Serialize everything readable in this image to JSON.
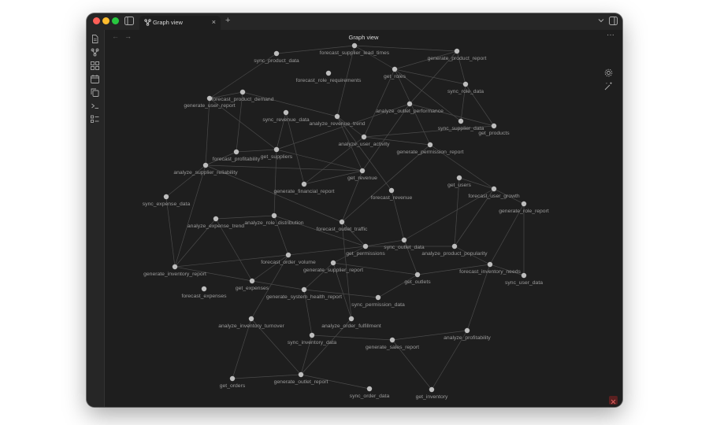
{
  "window": {
    "tab_label": "Graph view",
    "tab_close": "×",
    "new_tab": "+",
    "view_title": "Graph view",
    "nav_back": "←",
    "nav_forward": "→",
    "more_options": "···"
  },
  "colors": {
    "window_bg": "#1e1e1e",
    "node": "#bdbdbd",
    "edge": "#4a4a4a",
    "label": "#9a9a9a"
  },
  "graph": {
    "nodes": [
      {
        "id": "sync_product_data",
        "label": "sync_product_data"
      },
      {
        "id": "forecast_supplier_lead_times",
        "label": "forecast_supplier_lead_times"
      },
      {
        "id": "generate_product_report",
        "label": "generate_product_report"
      },
      {
        "id": "get_roles",
        "label": "get_roles"
      },
      {
        "id": "forecast_role_requirements",
        "label": "forecast_role_requirements"
      },
      {
        "id": "sync_role_data",
        "label": "sync_role_data"
      },
      {
        "id": "forecast_product_demand",
        "label": "forecast_product_demand"
      },
      {
        "id": "generate_user_report",
        "label": "generate_user_report"
      },
      {
        "id": "analyze_outlet_performance",
        "label": "analyze_outlet_performance"
      },
      {
        "id": "sync_revenue_data",
        "label": "sync_revenue_data"
      },
      {
        "id": "analyze_revenue_trend",
        "label": "analyze_revenue_trend"
      },
      {
        "id": "sync_supplier_data",
        "label": "sync_supplier_data"
      },
      {
        "id": "get_products",
        "label": "get_products"
      },
      {
        "id": "analyze_user_activity",
        "label": "analyze_user_activity"
      },
      {
        "id": "generate_permission_report",
        "label": "generate_permission_report"
      },
      {
        "id": "forecast_profitability",
        "label": "forecast_profitability"
      },
      {
        "id": "get_suppliers",
        "label": "get_suppliers"
      },
      {
        "id": "analyze_supplier_reliability",
        "label": "analyze_supplier_reliability"
      },
      {
        "id": "get_revenue",
        "label": "get_revenue"
      },
      {
        "id": "generate_financial_report",
        "label": "generate_financial_report"
      },
      {
        "id": "get_users",
        "label": "get_users"
      },
      {
        "id": "forecast_user_growth",
        "label": "forecast_user_growth"
      },
      {
        "id": "forecast_revenue",
        "label": "forecast_revenue"
      },
      {
        "id": "generate_role_report",
        "label": "generate_role_report"
      },
      {
        "id": "sync_expense_data",
        "label": "sync_expense_data"
      },
      {
        "id": "analyze_expense_trend",
        "label": "analyze_expense_trend"
      },
      {
        "id": "analyze_role_distribution",
        "label": "analyze_role_distribution"
      },
      {
        "id": "forecast_outlet_traffic",
        "label": "forecast_outlet_traffic"
      },
      {
        "id": "sync_outlet_data",
        "label": "sync_outlet_data"
      },
      {
        "id": "get_permissions",
        "label": "get_permissions"
      },
      {
        "id": "analyze_product_popularity",
        "label": "analyze_product_popularity"
      },
      {
        "id": "forecast_order_volume",
        "label": "forecast_order_volume"
      },
      {
        "id": "generate_supplier_report",
        "label": "generate_supplier_report"
      },
      {
        "id": "generate_inventory_report",
        "label": "generate_inventory_report"
      },
      {
        "id": "forecast_inventory_needs",
        "label": "forecast_inventory_needs"
      },
      {
        "id": "get_outlets",
        "label": "get_outlets"
      },
      {
        "id": "sync_user_data",
        "label": "sync_user_data"
      },
      {
        "id": "get_expenses",
        "label": "get_expenses"
      },
      {
        "id": "forecast_expenses",
        "label": "forecast_expenses"
      },
      {
        "id": "generate_system_health_report",
        "label": "generate_system_health_report"
      },
      {
        "id": "sync_permission_data",
        "label": "sync_permission_data"
      },
      {
        "id": "analyze_inventory_turnover",
        "label": "analyze_inventory_turnover"
      },
      {
        "id": "analyze_order_fulfillment",
        "label": "analyze_order_fulfillment"
      },
      {
        "id": "sync_inventory_data",
        "label": "sync_inventory_data"
      },
      {
        "id": "analyze_profitability",
        "label": "analyze_profitability"
      },
      {
        "id": "generate_sales_report",
        "label": "generate_sales_report"
      },
      {
        "id": "generate_outlet_report",
        "label": "generate_outlet_report"
      },
      {
        "id": "get_orders",
        "label": "get_orders"
      },
      {
        "id": "sync_order_data",
        "label": "sync_order_data"
      },
      {
        "id": "get_inventory",
        "label": "get_inventory"
      }
    ],
    "edges": [
      [
        "sync_product_data",
        "forecast_supplier_lead_times"
      ],
      [
        "sync_product_data",
        "generate_user_report"
      ],
      [
        "forecast_supplier_lead_times",
        "generate_product_report"
      ],
      [
        "forecast_supplier_lead_times",
        "get_roles"
      ],
      [
        "forecast_supplier_lead_times",
        "analyze_revenue_trend"
      ],
      [
        "generate_product_report",
        "get_roles"
      ],
      [
        "generate_product_report",
        "sync_role_data"
      ],
      [
        "generate_product_report",
        "analyze_outlet_performance"
      ],
      [
        "get_roles",
        "sync_role_data"
      ],
      [
        "get_roles",
        "analyze_user_activity"
      ],
      [
        "get_roles",
        "sync_supplier_data"
      ],
      [
        "get_roles",
        "generate_permission_report"
      ],
      [
        "sync_role_data",
        "sync_supplier_data"
      ],
      [
        "sync_role_data",
        "get_products"
      ],
      [
        "analyze_outlet_performance",
        "get_products"
      ],
      [
        "analyze_outlet_performance",
        "get_suppliers"
      ],
      [
        "analyze_outlet_performance",
        "get_revenue"
      ],
      [
        "generate_user_report",
        "forecast_product_demand"
      ],
      [
        "generate_user_report",
        "analyze_supplier_reliability"
      ],
      [
        "generate_user_report",
        "get_suppliers"
      ],
      [
        "forecast_product_demand",
        "analyze_revenue_trend"
      ],
      [
        "forecast_product_demand",
        "forecast_profitability"
      ],
      [
        "sync_revenue_data",
        "get_suppliers"
      ],
      [
        "sync_revenue_data",
        "generate_financial_report"
      ],
      [
        "analyze_revenue_trend",
        "analyze_user_activity"
      ],
      [
        "analyze_revenue_trend",
        "get_revenue"
      ],
      [
        "analyze_revenue_trend",
        "forecast_revenue"
      ],
      [
        "analyze_user_activity",
        "generate_financial_report"
      ],
      [
        "analyze_user_activity",
        "generate_permission_report"
      ],
      [
        "analyze_user_activity",
        "get_products"
      ],
      [
        "generate_permission_report",
        "forecast_user_growth"
      ],
      [
        "generate_permission_report",
        "forecast_outlet_traffic"
      ],
      [
        "forecast_profitability",
        "analyze_supplier_reliability"
      ],
      [
        "forecast_profitability",
        "get_suppliers"
      ],
      [
        "get_suppliers",
        "get_revenue"
      ],
      [
        "get_suppliers",
        "analyze_role_distribution"
      ],
      [
        "analyze_supplier_reliability",
        "get_revenue"
      ],
      [
        "analyze_supplier_reliability",
        "sync_expense_data"
      ],
      [
        "analyze_supplier_reliability",
        "forecast_outlet_traffic"
      ],
      [
        "analyze_supplier_reliability",
        "generate_inventory_report"
      ],
      [
        "get_revenue",
        "generate_financial_report"
      ],
      [
        "get_revenue",
        "forecast_outlet_traffic"
      ],
      [
        "get_users",
        "forecast_user_growth"
      ],
      [
        "forecast_user_growth",
        "generate_role_report"
      ],
      [
        "forecast_user_growth",
        "analyze_product_popularity"
      ],
      [
        "forecast_user_growth",
        "sync_outlet_data"
      ],
      [
        "generate_role_report",
        "sync_user_data"
      ],
      [
        "generate_role_report",
        "forecast_inventory_needs"
      ],
      [
        "forecast_revenue",
        "sync_outlet_data"
      ],
      [
        "sync_expense_data",
        "generate_inventory_report"
      ],
      [
        "analyze_expense_trend",
        "generate_inventory_report"
      ],
      [
        "analyze_expense_trend",
        "get_expenses"
      ],
      [
        "analyze_expense_trend",
        "analyze_role_distribution"
      ],
      [
        "analyze_role_distribution",
        "forecast_order_volume"
      ],
      [
        "analyze_role_distribution",
        "get_permissions"
      ],
      [
        "forecast_outlet_traffic",
        "get_permissions"
      ],
      [
        "forecast_outlet_traffic",
        "analyze_order_fulfillment"
      ],
      [
        "sync_outlet_data",
        "get_outlets"
      ],
      [
        "sync_outlet_data",
        "get_permissions"
      ],
      [
        "get_permissions",
        "forecast_order_volume"
      ],
      [
        "get_permissions",
        "generate_supplier_report"
      ],
      [
        "get_permissions",
        "analyze_product_popularity"
      ],
      [
        "analyze_product_popularity",
        "forecast_inventory_needs"
      ],
      [
        "analyze_product_popularity",
        "get_users"
      ],
      [
        "forecast_order_volume",
        "generate_inventory_report"
      ],
      [
        "forecast_order_volume",
        "get_expenses"
      ],
      [
        "forecast_order_volume",
        "analyze_inventory_turnover"
      ],
      [
        "generate_supplier_report",
        "generate_system_health_report"
      ],
      [
        "generate_supplier_report",
        "get_outlets"
      ],
      [
        "generate_supplier_report",
        "analyze_order_fulfillment"
      ],
      [
        "generate_inventory_report",
        "get_expenses"
      ],
      [
        "get_expenses",
        "generate_system_health_report"
      ],
      [
        "forecast_inventory_needs",
        "sync_user_data"
      ],
      [
        "forecast_inventory_needs",
        "get_outlets"
      ],
      [
        "generate_system_health_report",
        "sync_permission_data"
      ],
      [
        "generate_system_health_report",
        "sync_inventory_data"
      ],
      [
        "get_outlets",
        "sync_permission_data"
      ],
      [
        "analyze_inventory_turnover",
        "get_orders"
      ],
      [
        "analyze_inventory_turnover",
        "generate_outlet_report"
      ],
      [
        "sync_inventory_data",
        "generate_sales_report"
      ],
      [
        "sync_inventory_data",
        "generate_outlet_report"
      ],
      [
        "generate_sales_report",
        "analyze_profitability"
      ],
      [
        "generate_sales_report",
        "get_inventory"
      ],
      [
        "analyze_profitability",
        "forecast_inventory_needs"
      ],
      [
        "analyze_profitability",
        "get_inventory"
      ],
      [
        "generate_outlet_report",
        "get_orders"
      ],
      [
        "generate_outlet_report",
        "sync_order_data"
      ],
      [
        "generate_outlet_report",
        "analyze_order_fulfillment"
      ]
    ]
  }
}
